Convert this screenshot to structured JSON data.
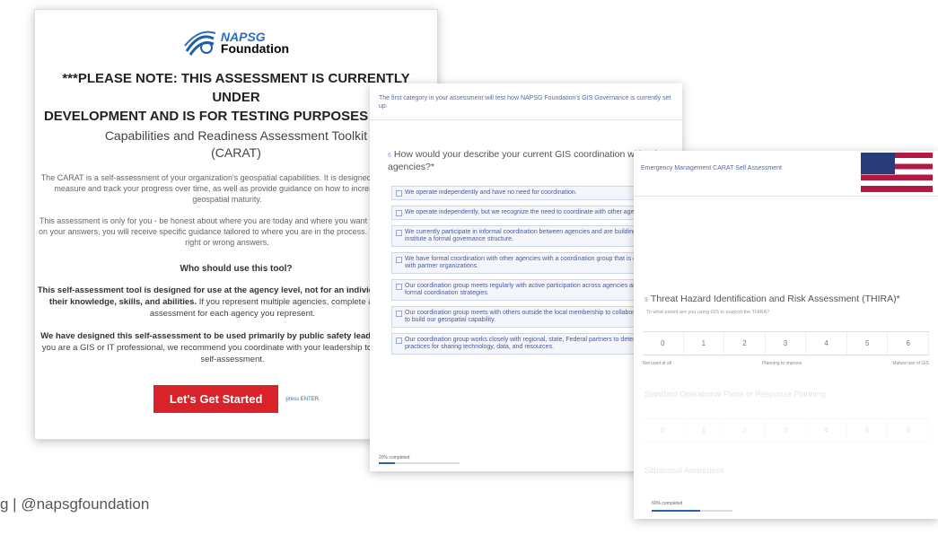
{
  "card1": {
    "logo_line1": "NAPSG",
    "logo_line2": "Foundation",
    "note_line1": "***PLEASE NOTE: THIS ASSESSMENT IS CURRENTLY UNDER",
    "note_line2": "DEVELOPMENT AND IS FOR TESTING PURPOSES ONLY!***",
    "title_line1": "Capabilities and Readiness Assessment Toolkit",
    "title_line2": "(CARAT)",
    "intro": "The CARAT is a self-assessment of your organization's geospatial capabilities. It is designed to help you measure and track your progress over time, as well as provide guidance on how to increase your geospatial maturity.",
    "honest": "This assessment is only for you - be honest about where you are today and where you want to go. Based on your answers, you will receive specific guidance tailored to where you are in the process. There are no right or wrong answers.",
    "who_heading": "Who should use this tool?",
    "who_bold": "This self-assessment tool is designed for use at the agency level, not for an individual to assess their knowledge, skills, and abilities.",
    "who_rest": " If you represent multiple agencies, complete an individual assessment for each agency you represent.",
    "designed_bold": "We have designed this self-assessment to be used primarily by public safety leadership first.",
    "designed_rest": " If you are a GIS or IT professional, we recommend you coordinate with your leadership to complete the self-assessment.",
    "start_button": "Let's Get Started",
    "enter_hint": "press ENTER"
  },
  "card2": {
    "intro": "The first category in your assessment will test how NAPSG Foundation's GIS Governance is currently set up.",
    "question_number": "6",
    "question": "How would your describe your current GIS coordination with other agencies?*",
    "options": [
      "We operate independently and have no need for coordination.",
      "We operate independently, but we recognize the need to coordinate with other agencies.",
      "We currently participate in informal coordination between agencies and are building a plan to institute a formal governance structure.",
      "We have formal coordination with other agencies with a coordination group that is established with partner organizations.",
      "Our coordination group meets regularly with active participation across agencies and has created formal coordination strategies.",
      "Our coordination group meets with others outside the local membership to collaborate on strategy to build our geospatial capability.",
      "Our coordination group works closely with regional, state, Federal partners to determine best practices for sharing technology, data, and resources."
    ],
    "progress_label": "20% completed",
    "progress_value": 0.2
  },
  "card3": {
    "header": "Emergency Management CARAT Self Assessment",
    "question_number": "9",
    "question": "Threat Hazard Identification and Risk Assessment (THIRA)*",
    "instruction": "To what extent are you using GIS to support the THIRA?",
    "scale": [
      "0",
      "1",
      "2",
      "3",
      "4",
      "5",
      "6"
    ],
    "scale_low": "Not used at all",
    "scale_mid": "Planning to improve",
    "scale_high": "Mature use of GIS",
    "next_question": "Standard Operational Plans or Response Planning",
    "next_scale": [
      "0",
      "1",
      "2",
      "3",
      "4",
      "5",
      "6"
    ],
    "third_question": "Situational Awareness",
    "progress_label": "60% completed",
    "progress_value": 0.6
  },
  "footer": "g | @napsgfoundation"
}
